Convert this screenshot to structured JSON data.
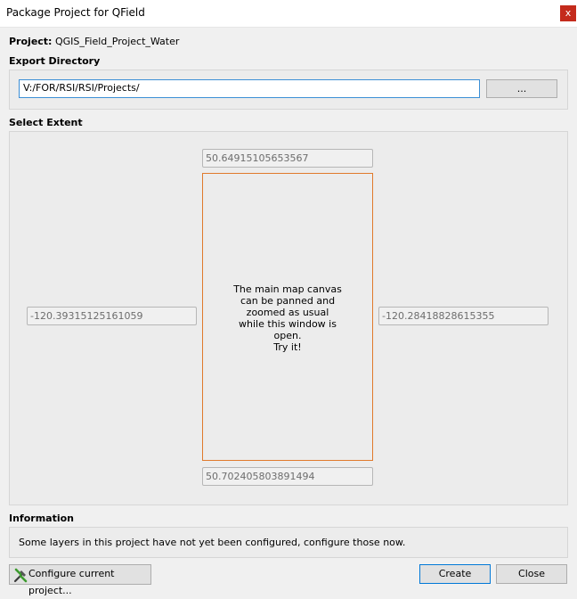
{
  "window": {
    "title": "Package Project for QField",
    "close_glyph": "x"
  },
  "project": {
    "label": "Project:",
    "name": "QGIS_Field_Project_Water"
  },
  "export": {
    "section_title": "Export Directory",
    "directory_value": "V:/FOR/RSI/RSI/Projects/",
    "browse_label": "..."
  },
  "extent": {
    "section_title": "Select Extent",
    "north": "50.64915105653567",
    "south": "50.702405803891494",
    "west": "-120.39315125161059",
    "east": "-120.28418828615355",
    "map_hint": [
      "The main map canvas",
      "can be panned and",
      "zoomed as usual",
      "while this window is",
      "open.",
      "Try it!"
    ]
  },
  "information": {
    "section_title": "Information",
    "message": "Some layers in this project have not yet been configured, configure those now."
  },
  "buttons": {
    "configure_label": "Configure current project...",
    "configure_icon": "tools-icon",
    "create_label": "Create",
    "close_label": "Close"
  },
  "colors": {
    "map_border": "#e07a2c",
    "close_button": "#c42b1c",
    "focus_border": "#0078d7"
  }
}
